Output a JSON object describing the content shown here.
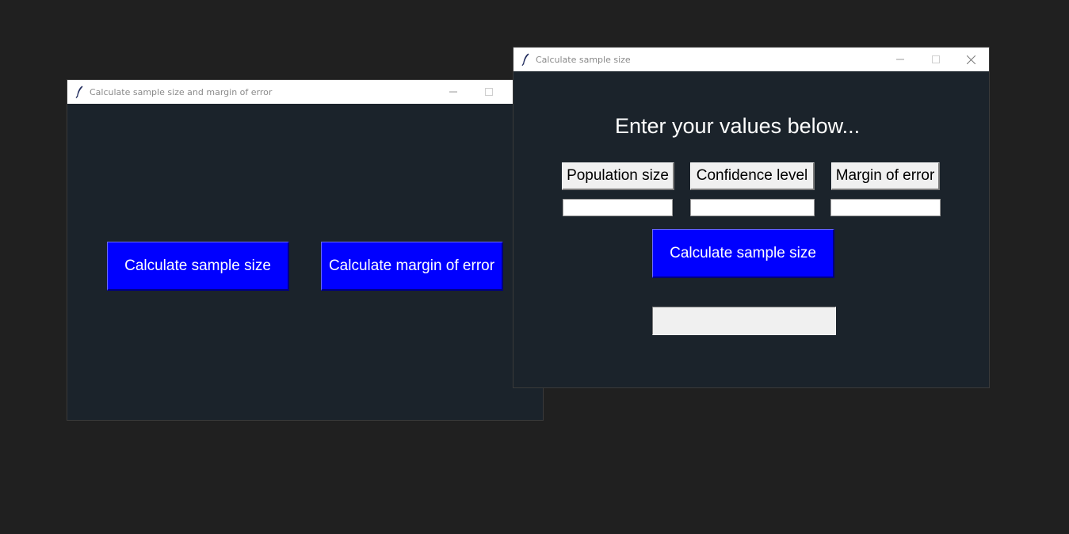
{
  "windows": {
    "main": {
      "title": "Calculate sample size and margin of error",
      "buttons": {
        "sample_size": "Calculate sample size",
        "margin_of_error": "Calculate margin of error"
      }
    },
    "sample": {
      "title": "Calculate sample size",
      "heading": "Enter your values below...",
      "labels": {
        "population": "Population size",
        "confidence": "Confidence level",
        "margin": "Margin of error"
      },
      "inputs": {
        "population": "",
        "confidence": "",
        "margin": ""
      },
      "calculate_button": "Calculate sample size",
      "result": ""
    }
  },
  "colors": {
    "desktop_bg": "#202020",
    "window_bg": "#1b232b",
    "accent_button": "#0000ff",
    "button_text": "#ffffff"
  },
  "icons": {
    "app_icon": "tk-feather-icon",
    "minimize": "minimize-icon",
    "maximize": "maximize-icon",
    "close": "close-icon"
  }
}
